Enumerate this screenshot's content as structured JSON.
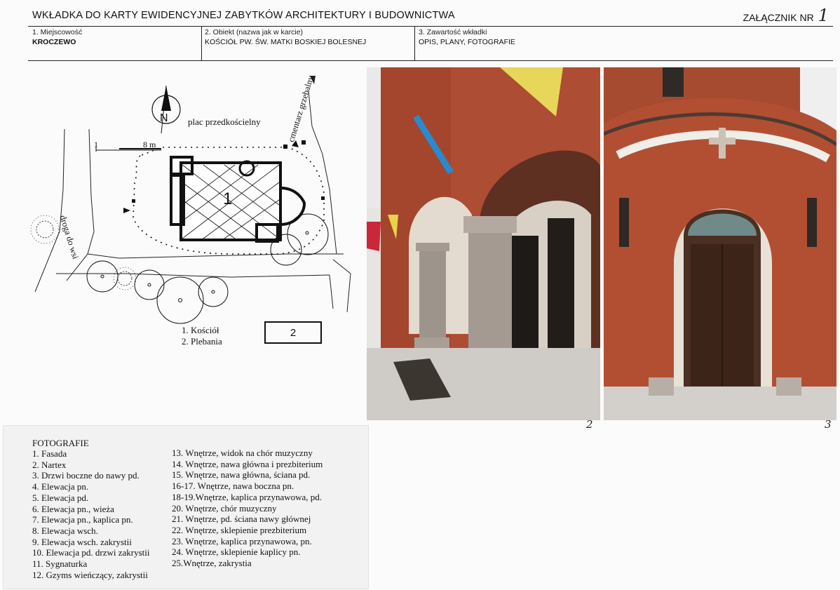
{
  "header": {
    "title": "WKŁADKA DO KARTY EWIDENCYJNEJ ZABYTKÓW ARCHITEKTURY I BUDOWNICTWA",
    "annex_label": "ZAŁĄCZNIK NR",
    "annex_number": "1"
  },
  "fields": [
    {
      "label": "1. Miejscowość",
      "value": "KROCZEWO"
    },
    {
      "label": "2. Obiekt (nazwa jak w karcie)",
      "value": "KOŚCIÓŁ PW. ŚW. MATKI BOSKIEJ BOLESNEJ"
    },
    {
      "label": "3. Zawartość wkładki",
      "value": "OPIS, PLANY, FOTOGRAFIE"
    }
  ],
  "map": {
    "north_label": "N",
    "square_label": "plac przedkościelny",
    "cemetery_label": "cmentarz grzebalny",
    "road_label": "droga do wsi",
    "scale_start": "1",
    "scale_end": "8 m",
    "church_number": "1",
    "legend": [
      "1. Kościół",
      "2. Plebania"
    ],
    "legend_box": "2"
  },
  "photos": [
    {
      "number": "2",
      "icon": "church-porch-photo"
    },
    {
      "number": "3",
      "icon": "church-side-door-photo"
    }
  ],
  "photo_list": {
    "heading": "FOTOGRAFIE",
    "left": [
      "1. Fasada",
      "2. Nartex",
      "3. Drzwi boczne do nawy pd.",
      "4. Elewacja pn.",
      "5. Elewacja pd.",
      "6. Elewacja pn., wieża",
      "7. Elewacja pn., kaplica pn.",
      "8. Elewacja wsch.",
      "9. Elewacja wsch. zakrystii",
      "10. Elewacja pd. drzwi zakrystii",
      "11. Sygnaturka",
      "12. Gzyms wieńczący, zakrystii"
    ],
    "right": [
      "13. Wnętrze, widok na chór muzyczny",
      "14. Wnętrze, nawa główna i prezbiterium",
      "15. Wnętrze, nawa główna, ściana pd.",
      "16-17. Wnętrze, nawa boczna pn.",
      "18-19.Wnętrze, kaplica przynawowa, pd.",
      "20. Wnętrze, chór muzyczny",
      "21. Wnętrze, pd. ściana nawy głównej",
      "22. Wnętrze, sklepienie prezbiterium",
      "23. Wnętrze, kaplica przynawowa, pn.",
      "24. Wnętrze, sklepienie kaplicy pn.",
      "25.Wnętrze, zakrystia"
    ]
  }
}
